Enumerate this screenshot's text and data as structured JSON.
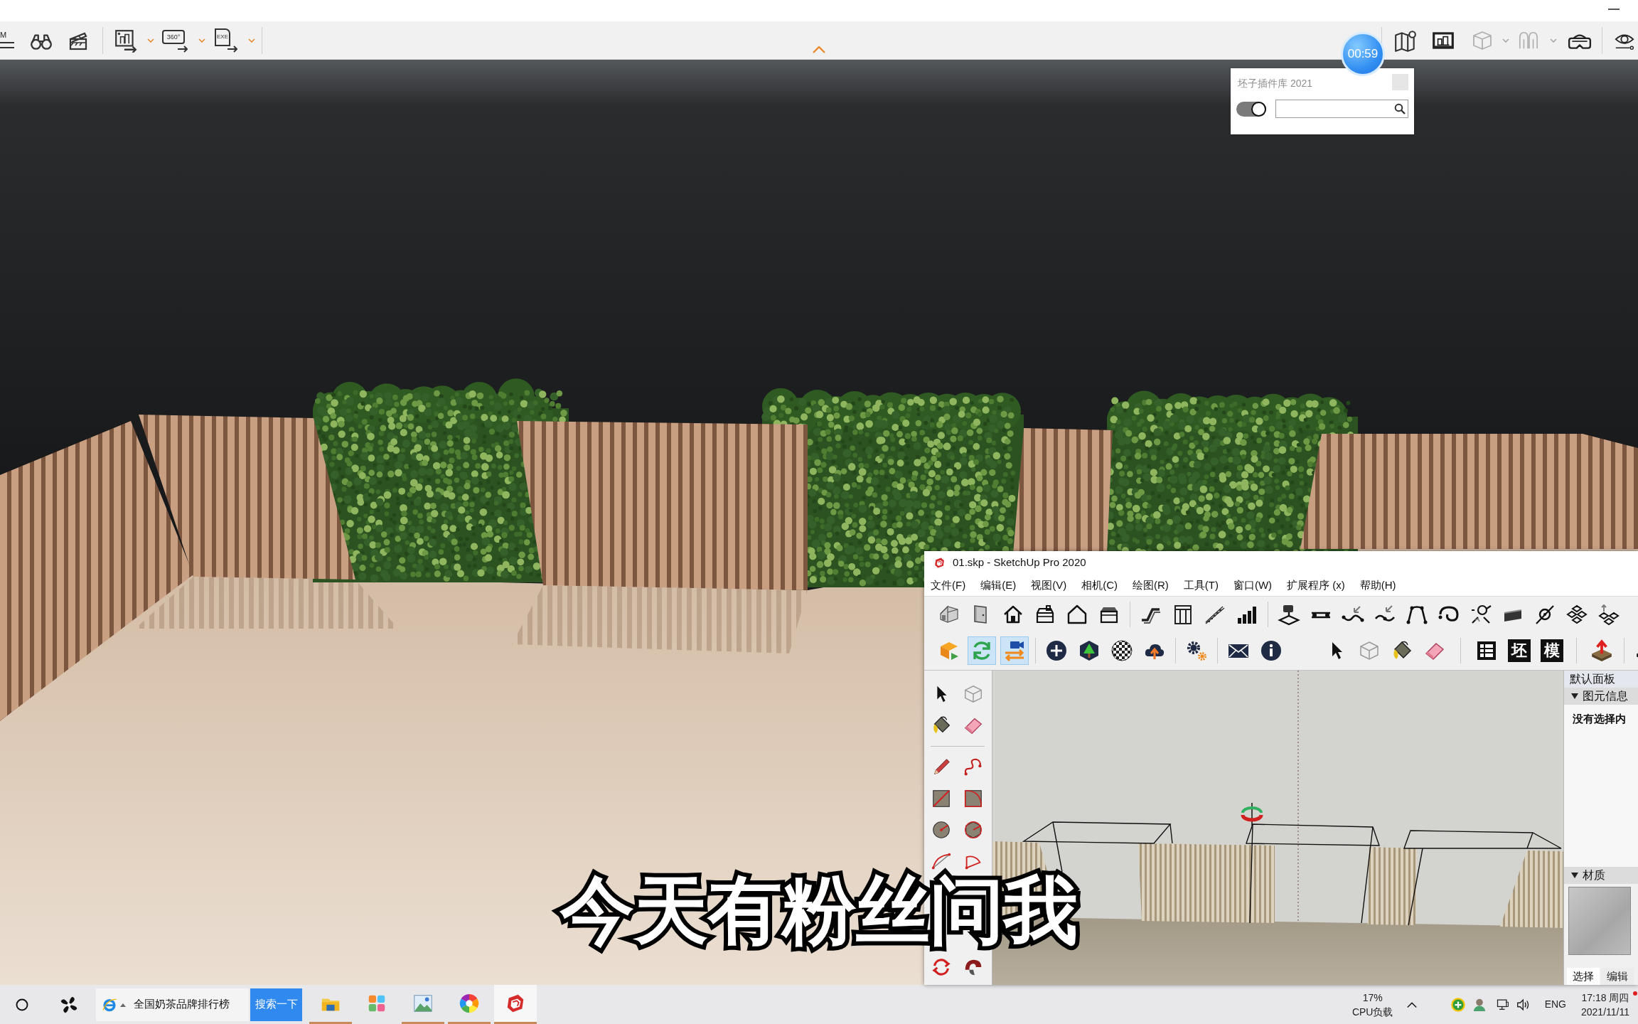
{
  "top_toolbar": {
    "menu_label": "M",
    "export_buttons": [
      {
        "kind": "image"
      },
      {
        "kind": "panorama",
        "label": "360°"
      },
      {
        "kind": "exe",
        "label": "EXE"
      }
    ]
  },
  "timer": "00:59",
  "plugin_popup": {
    "title": "坯子插件库 2021",
    "toggle_on": true
  },
  "sketchup": {
    "title": "01.skp - SketchUp Pro 2020",
    "menu": [
      "文件(F)",
      "编辑(E)",
      "视图(V)",
      "相机(C)",
      "绘图(R)",
      "工具(T)",
      "窗口(W)",
      "扩展程序 (x)",
      "帮助(H)"
    ],
    "toggle_buttons": [
      {
        "pressed": false
      },
      {
        "pressed": true
      },
      {
        "pressed": true
      }
    ],
    "glyph_buttons": [
      "坯",
      "模"
    ],
    "panel": {
      "title": "默认面板",
      "sections": [
        {
          "kind": "info",
          "title": "图元信息",
          "expanded": true,
          "text": "没有选择内"
        },
        {
          "kind": "material",
          "title": "材质",
          "expanded": true
        }
      ],
      "tabs": [
        {
          "label": "选择",
          "selected": true
        },
        {
          "label": "编辑",
          "selected": false
        }
      ]
    }
  },
  "subtitle": "今天有粉丝问我",
  "taskbar": {
    "search": {
      "value": "全国奶茶品牌排行榜",
      "button": "搜索一下"
    },
    "apps": [
      {
        "kind": "folder",
        "running": true,
        "active": false
      },
      {
        "kind": "tiles",
        "running": false,
        "active": false
      },
      {
        "kind": "image",
        "running": true,
        "active": false
      },
      {
        "kind": "color-wheel",
        "running": true,
        "active": false
      },
      {
        "kind": "sketchup",
        "running": true,
        "active": true
      }
    ],
    "cpu": {
      "percent": "17%",
      "label": "CPU负载"
    },
    "language": "ENG",
    "clock": {
      "time": "17:18 周四",
      "date": "2021/11/11"
    }
  }
}
